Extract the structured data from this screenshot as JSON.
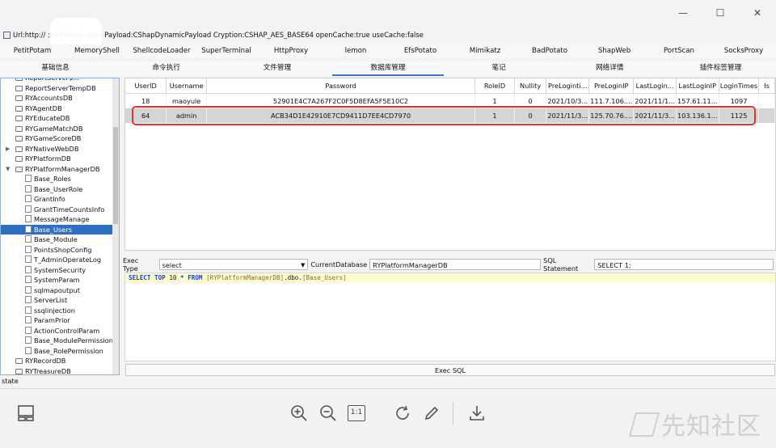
{
  "window": {
    "minimize": "—",
    "maximize": "☐",
    "close": "✕"
  },
  "urlbar": {
    "text": "Url:http://          :8089/help.aspx Payload:CShapDynamicPayload Cryption:CSHAP_AES_BASE64 openCache:true useCache:false"
  },
  "plugin_tabs": [
    "PetitPotam",
    "MemoryShell",
    "ShellcodeLoader",
    "SuperTerminal",
    "HttpProxy",
    "lemon",
    "EfsPotato",
    "Mimikatz",
    "BadPotato",
    "ShapWeb",
    "PortScan",
    "SocksProxy"
  ],
  "main_tabs": [
    "基础信息",
    "命令执行",
    "文件管理",
    "数据库管理",
    "笔记",
    "网络详情",
    "插件标签管理"
  ],
  "active_main_tab": "数据库管理",
  "tree": [
    {
      "label": "ReportServer$...",
      "type": "db",
      "indent": 0
    },
    {
      "label": "ReportServerTempDB",
      "type": "db",
      "indent": 0
    },
    {
      "label": "RYAccountsDB",
      "type": "db",
      "indent": 0
    },
    {
      "label": "RYAgentDB",
      "type": "db",
      "indent": 0
    },
    {
      "label": "RYEducateDB",
      "type": "db",
      "indent": 0
    },
    {
      "label": "RYGameMatchDB",
      "type": "db",
      "indent": 0
    },
    {
      "label": "RYGameScoreDB",
      "type": "db",
      "indent": 0
    },
    {
      "label": "RYNativeWebDB",
      "type": "db",
      "indent": 0,
      "toggle": "▶"
    },
    {
      "label": "RYPlatformDB",
      "type": "db",
      "indent": 0
    },
    {
      "label": "RYPlatformManagerDB",
      "type": "db-open",
      "indent": 0,
      "toggle": "▼"
    },
    {
      "label": "Base_Roles",
      "type": "table",
      "indent": 1
    },
    {
      "label": "Base_UserRole",
      "type": "table",
      "indent": 1
    },
    {
      "label": "GrantInfo",
      "type": "table",
      "indent": 1
    },
    {
      "label": "GrantTimeCountsInfo",
      "type": "table",
      "indent": 1
    },
    {
      "label": "MessageManage",
      "type": "table",
      "indent": 1
    },
    {
      "label": "Base_Users",
      "type": "table",
      "indent": 1,
      "selected": true
    },
    {
      "label": "Base_Module",
      "type": "table",
      "indent": 1
    },
    {
      "label": "PointsShopConfig",
      "type": "table",
      "indent": 1
    },
    {
      "label": "T_AdminOperateLog",
      "type": "table",
      "indent": 1
    },
    {
      "label": "SystemSecurity",
      "type": "table",
      "indent": 1
    },
    {
      "label": "SystemParam",
      "type": "table",
      "indent": 1
    },
    {
      "label": "sqlmapoutput",
      "type": "table",
      "indent": 1
    },
    {
      "label": "ServerList",
      "type": "table",
      "indent": 1
    },
    {
      "label": "ssqlinjection",
      "type": "table",
      "indent": 1
    },
    {
      "label": "ParamPrior",
      "type": "table",
      "indent": 1
    },
    {
      "label": "ActionControlParam",
      "type": "table",
      "indent": 1
    },
    {
      "label": "Base_ModulePermission",
      "type": "table",
      "indent": 1
    },
    {
      "label": "Base_RolePermission",
      "type": "table",
      "indent": 1
    },
    {
      "label": "RYRecordDB",
      "type": "db",
      "indent": 0
    },
    {
      "label": "RYTreasureDB",
      "type": "db",
      "indent": 0
    }
  ],
  "grid": {
    "columns": [
      "UserID",
      "Username",
      "Password",
      "RoleID",
      "Nullity",
      "PreLoginti...",
      "PreLoginIP",
      "LastLogin...",
      "LastLoginIP",
      "LoginTimes",
      "Is"
    ],
    "rows": [
      [
        "18",
        "maoyule",
        "52901E4C7A267F2C0F5D8EFA5F5E10C2",
        "1",
        "0",
        "2021/10/3...",
        "111.7.106....",
        "2021/11/1...",
        "157.61.11...",
        "1097",
        ""
      ],
      [
        "64",
        "admin",
        "ACB34D1E42910E7CD9411D7EE4CD7970",
        "1",
        "0",
        "2021/11/3...",
        "125.70.76....",
        "2021/11/3...",
        "103.136.1...",
        "1125",
        ""
      ]
    ],
    "selected_row": 1
  },
  "sql": {
    "exec_type_label": "Exec Type",
    "exec_type_value": "select",
    "current_db_label": "CurrentDatabase",
    "current_db_value": "RYPlatformManagerDB",
    "statement_label": "SQL Statement",
    "statement_value": "SELECT 1;",
    "editor": {
      "k1": "SELECT",
      "k2": "TOP",
      "n": "10",
      "star": "*",
      "k3": "FROM",
      "db": "[RYPlatformManagerDB]",
      "dot": ".dbo.",
      "tbl": "[Base_Users]"
    },
    "exec_button": "Exec SQL"
  },
  "status": "state",
  "toolbar_icons": [
    "layout-icon",
    "zoom-in-icon",
    "zoom-out-icon",
    "actual-size-icon",
    "rotate-icon",
    "edit-icon",
    "download-icon"
  ],
  "actual_size_label": "1:1",
  "watermark": "先知社区",
  "colors": {
    "selection": "#2d6fc0",
    "highlight_box": "#e8322f",
    "tab_underline": "#3b78c9",
    "sql_keyword": "#1a3fd8"
  }
}
